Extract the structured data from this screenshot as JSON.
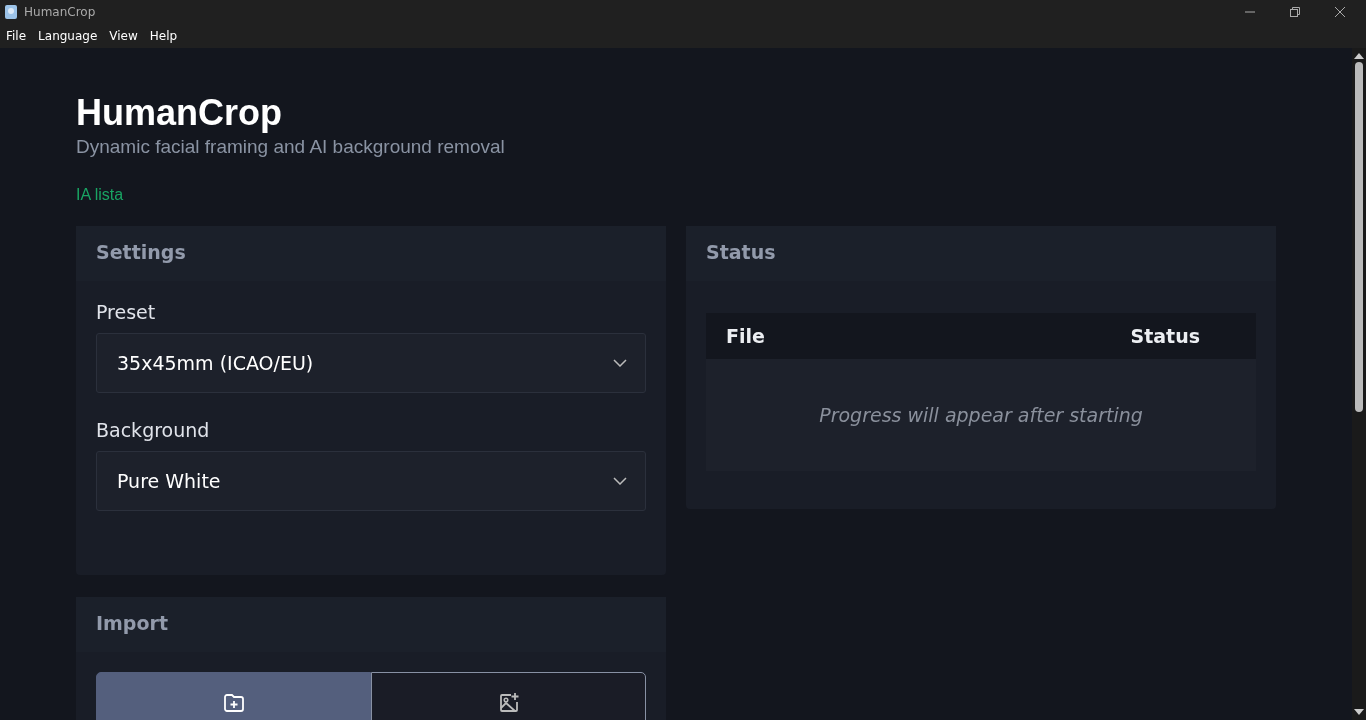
{
  "window": {
    "title": "HumanCrop"
  },
  "menu": [
    "File",
    "Language",
    "View",
    "Help"
  ],
  "app": {
    "title": "HumanCrop",
    "subtitle": "Dynamic facial framing and AI background removal",
    "status": "IA lista"
  },
  "settings": {
    "title": "Settings",
    "fields": [
      {
        "label": "Preset",
        "value": "35x45mm (ICAO/EU)"
      },
      {
        "label": "Background",
        "value": "Pure White"
      }
    ]
  },
  "import": {
    "title": "Import",
    "modes": [
      {
        "kind": "folder",
        "selected": true
      },
      {
        "kind": "image",
        "selected": false
      }
    ]
  },
  "status_panel": {
    "title": "Status",
    "columns": [
      "File",
      "Status"
    ],
    "empty_text": "Progress will appear after starting"
  }
}
